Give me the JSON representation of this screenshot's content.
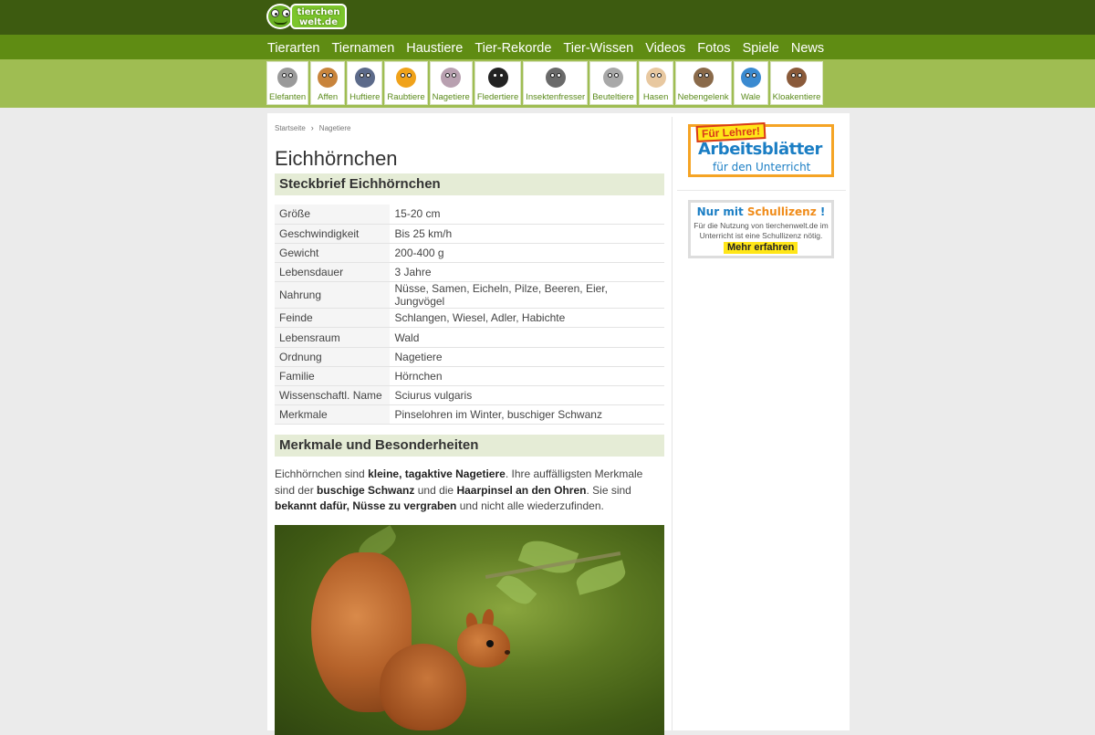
{
  "logo": {
    "text_line1": "tierchen",
    "text_line2": "welt.de"
  },
  "nav": {
    "items": [
      "Tierarten",
      "Tiernamen",
      "Haustiere",
      "Tier-Rekorde",
      "Tier-Wissen",
      "Videos",
      "Fotos",
      "Spiele",
      "News"
    ]
  },
  "subnav": {
    "items": [
      {
        "label": "Elefanten",
        "icon": "elephant-icon",
        "color": "#9a9a9a"
      },
      {
        "label": "Affen",
        "icon": "monkey-icon",
        "color": "#c8843c"
      },
      {
        "label": "Huftiere",
        "icon": "hoofed-animal-icon",
        "color": "#5c6a8a"
      },
      {
        "label": "Raubtiere",
        "icon": "lion-icon",
        "color": "#f0a21a"
      },
      {
        "label": "Nagetiere",
        "icon": "rodent-icon",
        "color": "#b8a0b0"
      },
      {
        "label": "Fledertiere",
        "icon": "bat-icon",
        "color": "#222222"
      },
      {
        "label": "Insektenfresser",
        "icon": "mole-icon",
        "color": "#6a6a6a"
      },
      {
        "label": "Beuteltiere",
        "icon": "koala-icon",
        "color": "#a8a8a8"
      },
      {
        "label": "Hasen",
        "icon": "rabbit-icon",
        "color": "#e8c8a0"
      },
      {
        "label": "Nebengelenk",
        "icon": "sloth-icon",
        "color": "#8a6a4a"
      },
      {
        "label": "Wale",
        "icon": "whale-icon",
        "color": "#3a8ad0"
      },
      {
        "label": "Kloakentiere",
        "icon": "platypus-icon",
        "color": "#8a5a3a"
      }
    ]
  },
  "breadcrumb": {
    "home": "Startseite",
    "current": "Nagetiere"
  },
  "page": {
    "title": "Eichhörnchen"
  },
  "profile": {
    "heading": "Steckbrief Eichhörnchen",
    "rows": [
      {
        "key": "Größe",
        "value": "15-20 cm"
      },
      {
        "key": "Geschwindigkeit",
        "value": "Bis 25 km/h"
      },
      {
        "key": "Gewicht",
        "value": "200-400 g"
      },
      {
        "key": "Lebensdauer",
        "value": "3 Jahre"
      },
      {
        "key": "Nahrung",
        "value": "Nüsse, Samen, Eicheln, Pilze, Beeren, Eier, Jungvögel"
      },
      {
        "key": "Feinde",
        "value": "Schlangen, Wiesel, Adler, Habichte"
      },
      {
        "key": "Lebensraum",
        "value": "Wald"
      },
      {
        "key": "Ordnung",
        "value": "Nagetiere"
      },
      {
        "key": "Familie",
        "value": "Hörnchen"
      },
      {
        "key": "Wissenschaftl. Name",
        "value": "Sciurus vulgaris"
      },
      {
        "key": "Merkmale",
        "value": "Pinselohren im Winter, buschiger Schwanz"
      }
    ]
  },
  "features": {
    "heading": "Merkmale und Besonderheiten",
    "p1": "Eichhörnchen sind ",
    "b1": "kleine, tagaktive Nagetiere",
    "p2": ". Ihre auffälligsten Merkmale sind der ",
    "b2": "buschige Schwanz",
    "p3": " und die ",
    "b3": "Haarpinsel an den Ohren",
    "p4": ". Sie sind ",
    "b4": "bekannt dafür, Nüsse zu vergraben",
    "p5": " und nicht alle wiederzufinden."
  },
  "sidebar": {
    "teacher": {
      "tag": "Für Lehrer!",
      "big": "Arbeitsblätter",
      "small": "für den Unterricht"
    },
    "license": {
      "head_a": "Nur mit ",
      "head_b": "Schullizenz",
      "head_c": " !",
      "text": "Für die Nutzung von tierchenwelt.de im Unterricht ist eine Schullizenz nötig.",
      "button": "Mehr erfahren"
    }
  }
}
